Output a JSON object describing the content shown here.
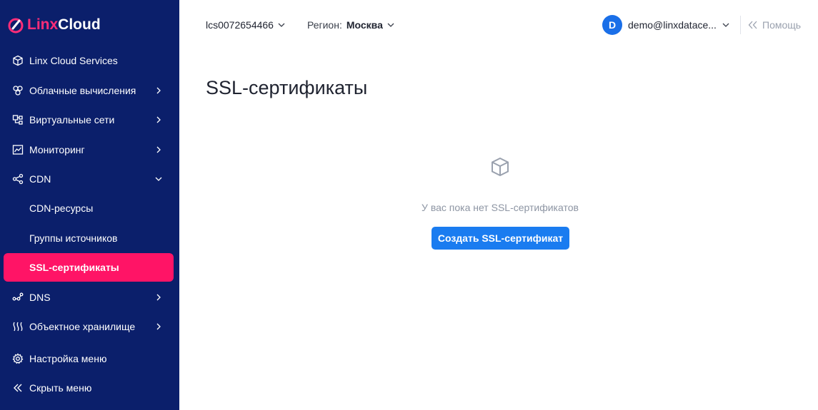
{
  "brand": {
    "part1": "Linx",
    "part2": "Cloud"
  },
  "sidebar": {
    "items": [
      {
        "label": "Linx Cloud Services",
        "icon": "cube-icon"
      },
      {
        "label": "Облачные вычисления",
        "icon": "compute-icon"
      },
      {
        "label": "Виртуальные сети",
        "icon": "network-icon"
      },
      {
        "label": "Мониторинг",
        "icon": "chart-icon"
      },
      {
        "label": "CDN",
        "icon": "share-icon"
      },
      {
        "label": "CDN-ресурсы"
      },
      {
        "label": "Группы источников"
      },
      {
        "label": "SSL-сертификаты"
      },
      {
        "label": "DNS",
        "icon": "dns-icon"
      },
      {
        "label": "Объектное хранилище",
        "icon": "storage-icon"
      },
      {
        "label": "Настройка меню",
        "icon": "gear-icon"
      },
      {
        "label": "Скрыть меню",
        "icon": "double-chevron-left-icon"
      }
    ]
  },
  "topbar": {
    "project": "lcs0072654466",
    "region_label": "Регион:",
    "region_value": "Москва",
    "user_initial": "D",
    "user_email": "demo@linxdatace...",
    "help": "Помощь"
  },
  "main": {
    "title": "SSL-сертификаты",
    "empty_text": "У вас пока нет SSL-сертификатов",
    "create_button": "Создать SSL-сертификат"
  },
  "colors": {
    "sidebar_bg": "#0b1f6b",
    "accent_pink": "#ff1466",
    "primary_blue": "#1a7cf0"
  }
}
